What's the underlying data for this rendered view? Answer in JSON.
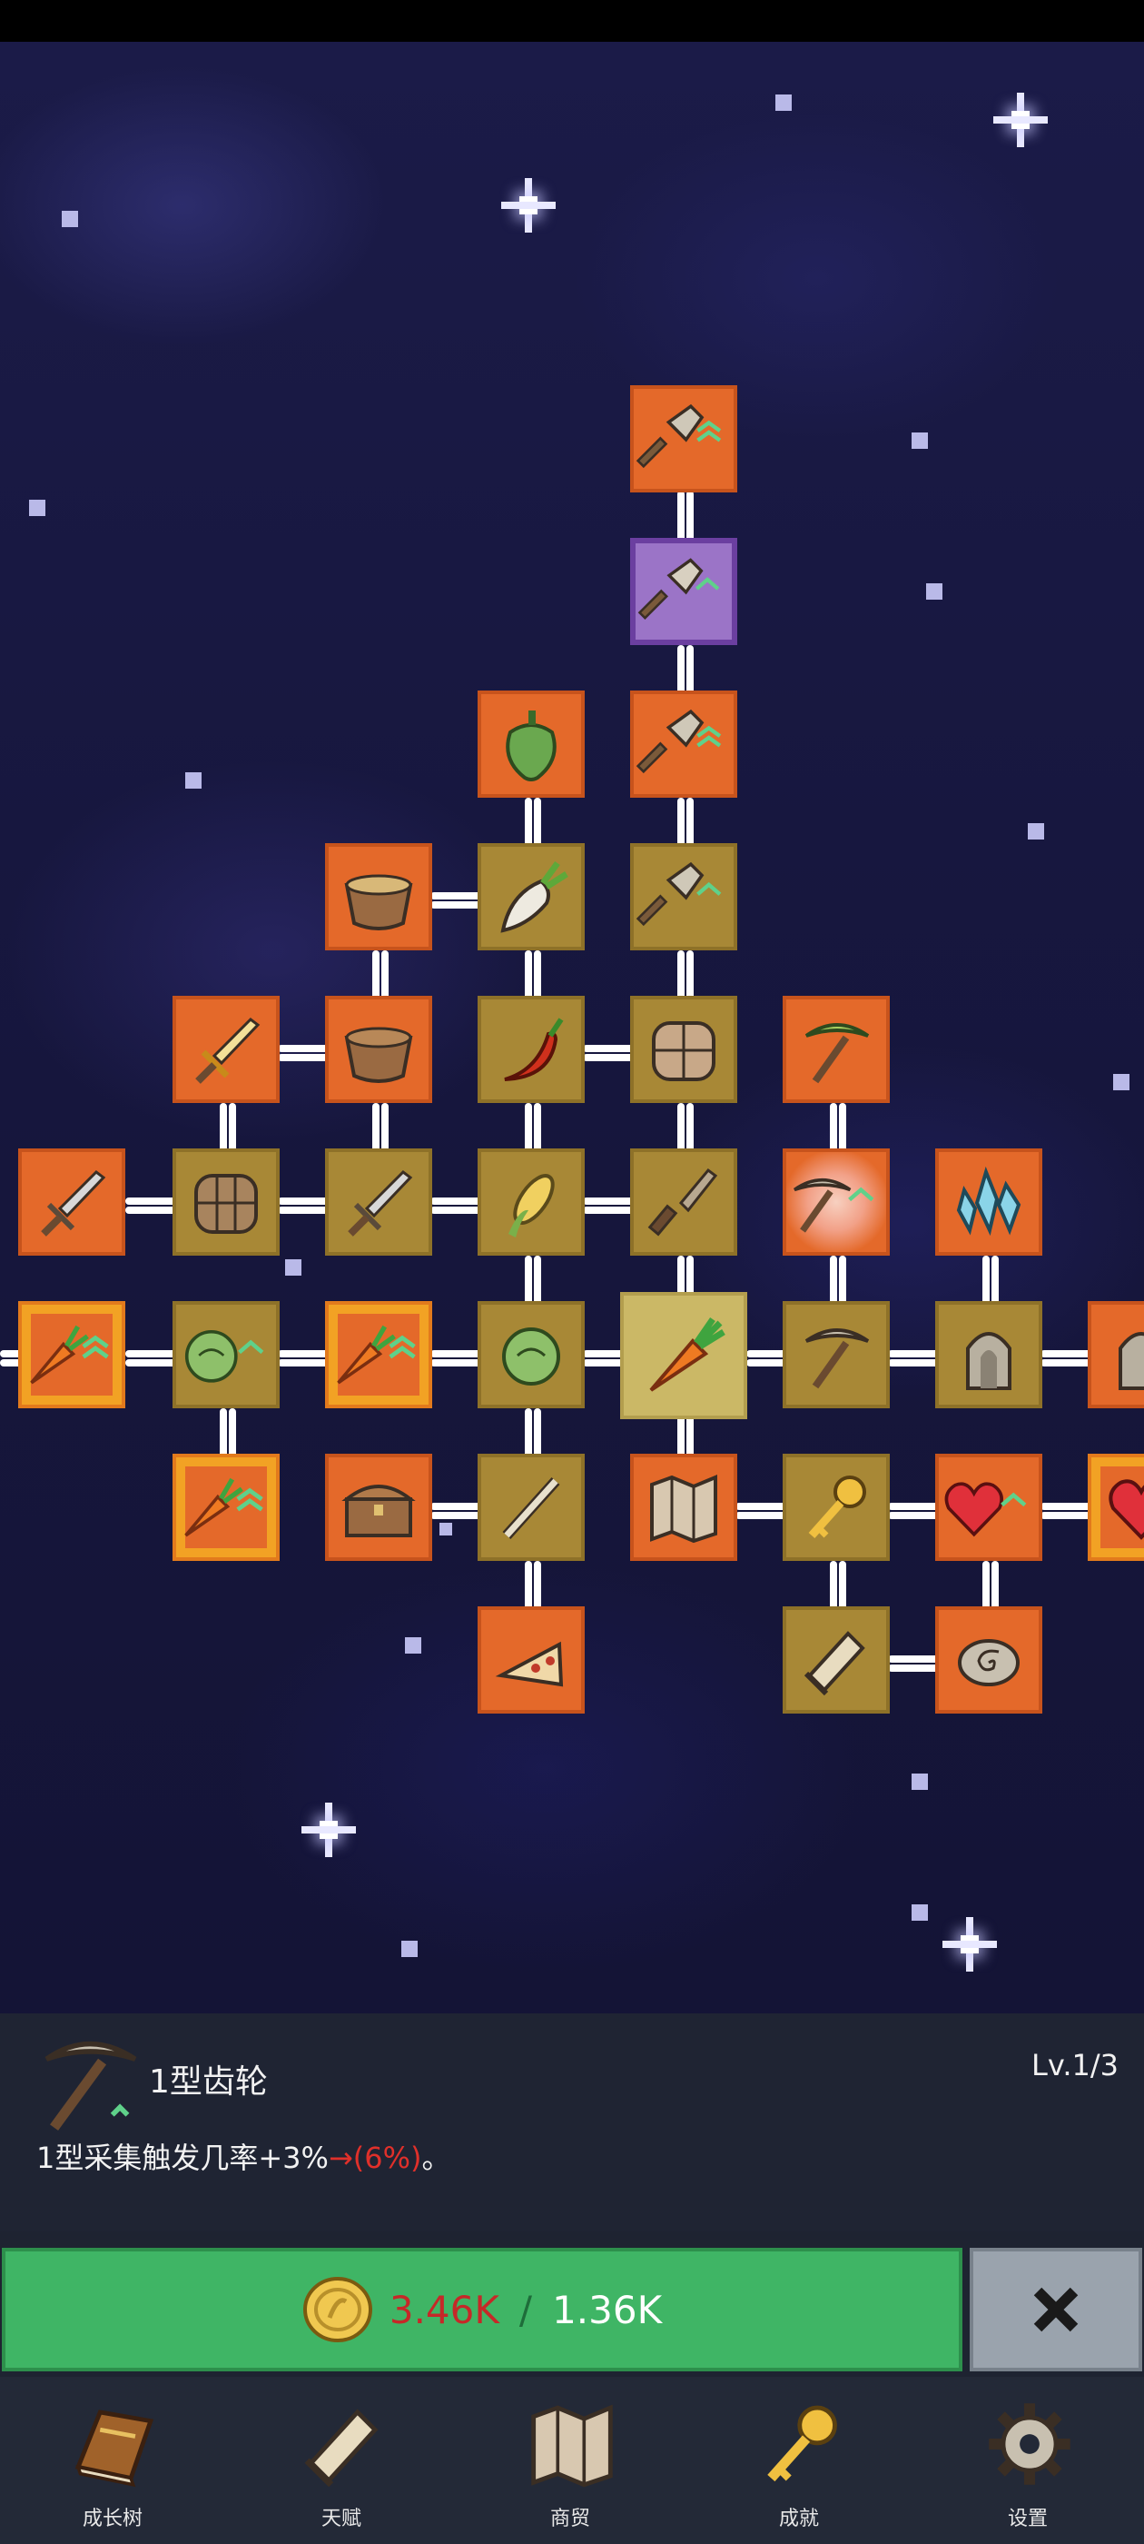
{
  "skill": {
    "name": "1型齿轮",
    "level": "Lv.1/3",
    "description": "1型采集触发几率+3%",
    "arrow": "→",
    "value": "(6%)",
    "suffix": "。"
  },
  "cost": {
    "current": "3.46K",
    "separator": "/",
    "required": "1.36K"
  },
  "nav": {
    "growth_tree": "成长树",
    "talent": "天赋",
    "trade": "商贸",
    "achievement": "成就",
    "settings": "设置"
  },
  "colors": {
    "node_active": "#e4692a",
    "node_locked": "#a88836",
    "node_rare": "#9b74c7",
    "button_upgrade": "#3fb565",
    "cost_insufficient": "#c62828"
  }
}
